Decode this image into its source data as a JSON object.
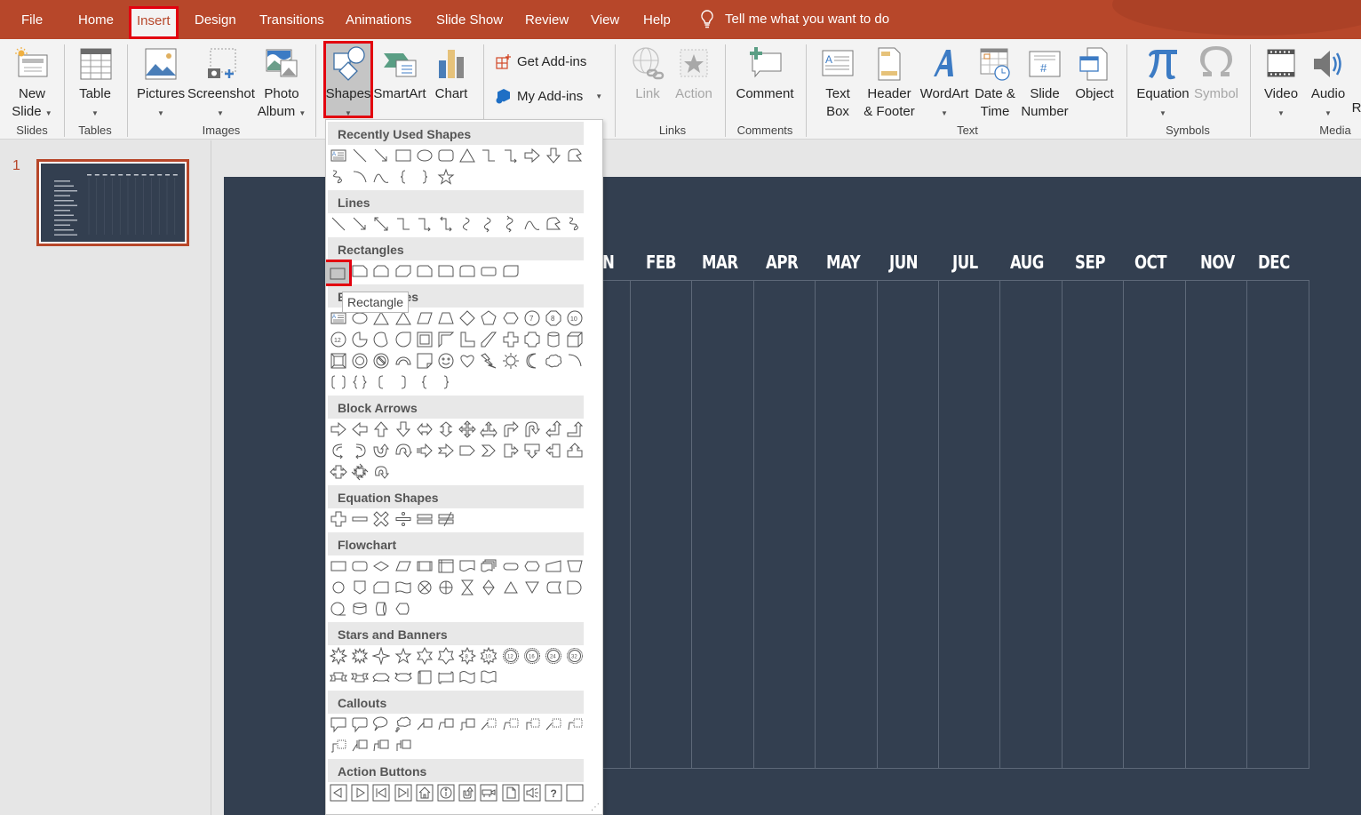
{
  "menu": {
    "tabs": [
      "File",
      "Home",
      "Insert",
      "Design",
      "Transitions",
      "Animations",
      "Slide Show",
      "Review",
      "View",
      "Help"
    ],
    "active_tab": "Insert",
    "tell_me": "Tell me what you want to do"
  },
  "ribbon": {
    "groups": {
      "slides": "Slides",
      "tables": "Tables",
      "images": "Images",
      "links": "Links",
      "comments": "Comments",
      "text": "Text",
      "symbols": "Symbols",
      "media": "Media"
    },
    "buttons": {
      "new_slide": [
        "New",
        "Slide"
      ],
      "table": "Table",
      "pictures": "Pictures",
      "screenshot": "Screenshot",
      "photo_album": [
        "Photo",
        "Album"
      ],
      "shapes": "Shapes",
      "smartart": "SmartArt",
      "chart": "Chart",
      "get_addins": "Get Add-ins",
      "my_addins": "My Add-ins",
      "link": "Link",
      "action": "Action",
      "comment": "Comment",
      "text_box": [
        "Text",
        "Box"
      ],
      "header_footer": [
        "Header",
        "& Footer"
      ],
      "wordart": "WordArt",
      "date_time": [
        "Date &",
        "Time"
      ],
      "slide_number": [
        "Slide",
        "Number"
      ],
      "object": "Object",
      "equation": "Equation",
      "symbol": "Symbol",
      "video": "Video",
      "audio": "Audio",
      "truncated": "R"
    }
  },
  "slide_pane": {
    "slide_number": "1"
  },
  "slide": {
    "months_visible": [
      "N",
      "FEB",
      "MAR",
      "APR",
      "MAY",
      "JUN",
      "JUL",
      "AUG",
      "SEP",
      "OCT",
      "NOV",
      "DEC"
    ],
    "background": "#333f50"
  },
  "shapes_dropdown": {
    "categories": [
      "Recently Used Shapes",
      "Lines",
      "Rectangles",
      "Basic Shapes",
      "Block Arrows",
      "Equation Shapes",
      "Flowchart",
      "Stars and Banners",
      "Callouts",
      "Action Buttons"
    ],
    "tooltip": "Rectangle",
    "selected_shape": "Rectangle"
  },
  "colors": {
    "accent": "#b7472a",
    "highlight": "#e3000f",
    "ribbon_bg": "#f3f3f3"
  }
}
